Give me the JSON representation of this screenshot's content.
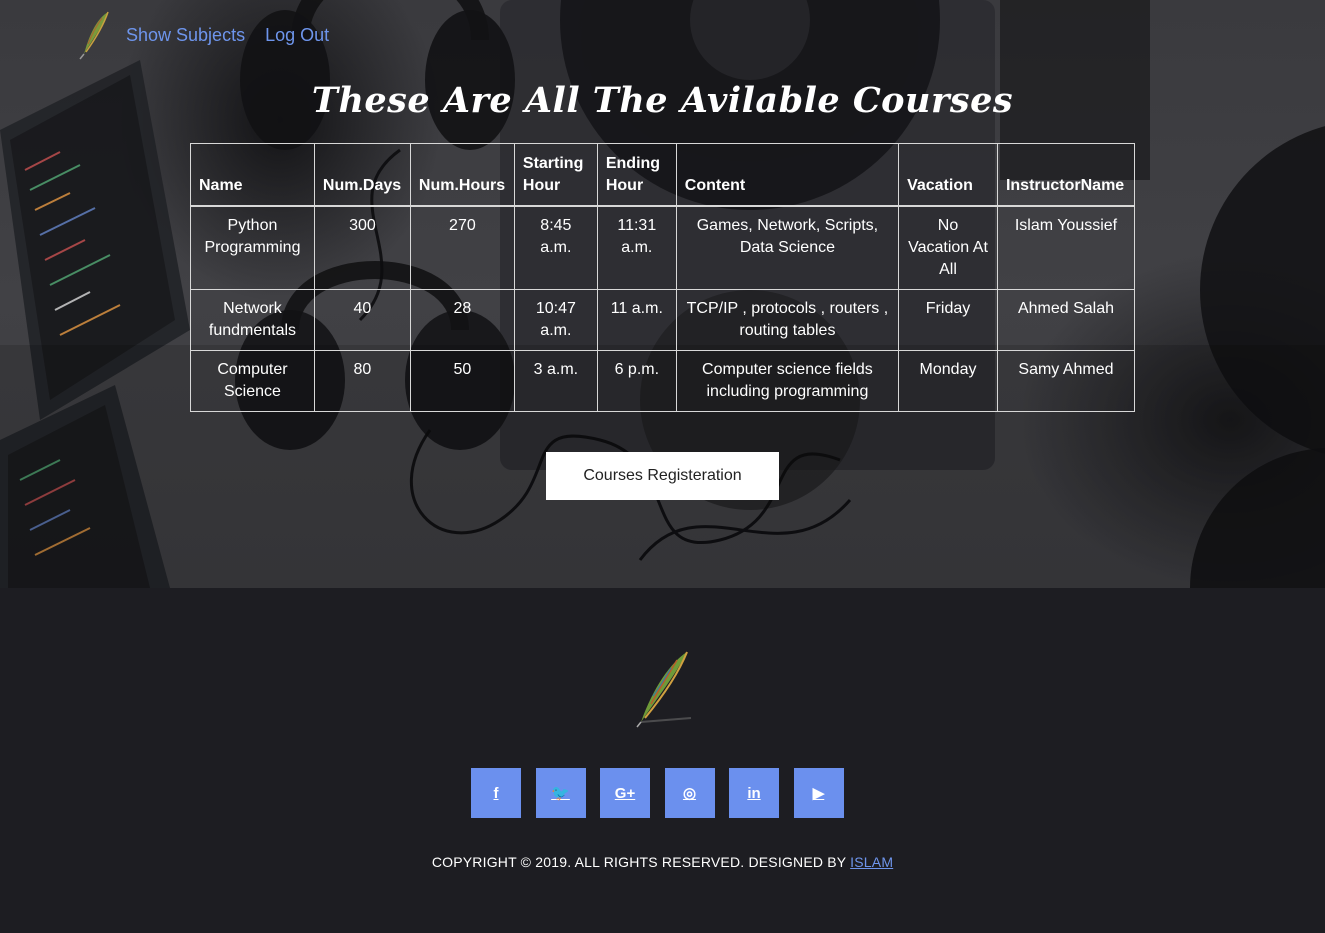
{
  "nav": {
    "logo_icon": "feather-quill-icon",
    "links": [
      "Show Subjects",
      "Log Out"
    ]
  },
  "page_title": "These Are All The Avilable Courses",
  "table": {
    "headers": [
      "Name",
      "Num.Days",
      "Num.Hours",
      "Starting Hour",
      "Ending Hour",
      "Content",
      "Vacation",
      "InstructorName"
    ],
    "rows": [
      [
        "Python Programming",
        "300",
        "270",
        "8:45 a.m.",
        "11:31 a.m.",
        "Games, Network, Scripts, Data Science",
        "No Vacation At All",
        "Islam Youssief"
      ],
      [
        "Network fundmentals",
        "40",
        "28",
        "10:47 a.m.",
        "11 a.m.",
        "TCP/IP , protocols , routers , routing tables",
        "Friday",
        "Ahmed Salah"
      ],
      [
        "Computer Science",
        "80",
        "50",
        "3 a.m.",
        "6 p.m.",
        "Computer science fields including programming",
        "Monday",
        "Samy Ahmed"
      ]
    ]
  },
  "register_button": "Courses Registeration",
  "footer": {
    "logo_icon": "feather-quill-icon",
    "socials": [
      {
        "icon": "facebook-icon",
        "glyph": "f"
      },
      {
        "icon": "twitter-icon",
        "glyph": "🐦"
      },
      {
        "icon": "google-plus-icon",
        "glyph": "G+"
      },
      {
        "icon": "instagram-icon",
        "glyph": "◎"
      },
      {
        "icon": "linkedin-icon",
        "glyph": "in"
      },
      {
        "icon": "youtube-icon",
        "glyph": "▶"
      }
    ],
    "copyright_text": "COPYRIGHT © 2019. ALL RIGHTS RESERVED. DESIGNED BY ",
    "copyright_author": "ISLAM"
  },
  "colors": {
    "link": "#6e95ec",
    "social_bg": "#6b90ee",
    "footer_bg": "#1d1d22"
  }
}
